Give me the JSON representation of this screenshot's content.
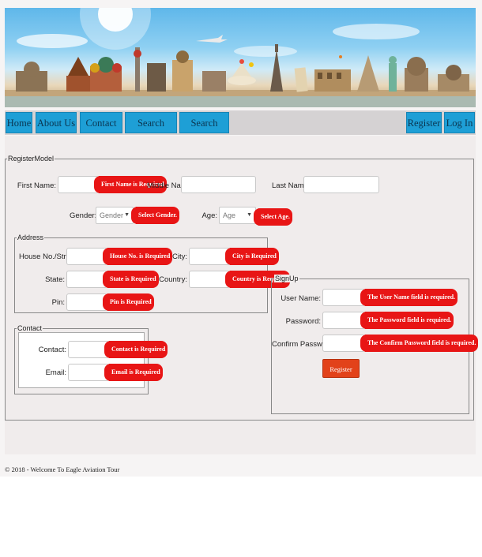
{
  "nav": {
    "left": [
      "Home",
      "About Us",
      "Contact Us",
      "Search Ticket",
      "Search Hotel"
    ],
    "right": [
      "Register",
      "Log In"
    ]
  },
  "form": {
    "legend": "RegisterModel",
    "first_name_label": "First Name:",
    "first_name_error": "First Name is Required",
    "middle_name_label": "Middle Name:",
    "last_name_label": "Last Name:",
    "gender_label": "Gender:",
    "gender_value": "Gender",
    "gender_error": "Select Gender.",
    "age_label": "Age:",
    "age_value": "Age",
    "age_error": "Select Age."
  },
  "address": {
    "legend": "Address",
    "house_label": "House No./Street:",
    "house_error": "House No. is Required",
    "city_label": "City:",
    "city_error": "City is Required",
    "state_label": "State:",
    "state_error": "State is Required",
    "country_label": "Country:",
    "country_error": "Country is Required",
    "pin_label": "Pin:",
    "pin_error": "Pin is Required"
  },
  "contact": {
    "legend": "Contact",
    "contact_label": "Contact:",
    "contact_error": "Contact is Required",
    "email_label": "Email:",
    "email_error": "Email is Required"
  },
  "signup": {
    "legend": "SignUp",
    "username_label": "User Name:",
    "username_error": "The User Name field is required.",
    "password_label": "Password:",
    "password_error": "The Password field is required.",
    "confirm_label": "Confirm Password:",
    "confirm_error": "The Confirm Password field is required.",
    "register_button": "Register"
  },
  "footer": "© 2018 - Welcome To Eagle Aviation Tour",
  "colors": {
    "nav_button": "#1e9fd6",
    "error_badge": "#e81515",
    "register_button": "#e2421a"
  }
}
